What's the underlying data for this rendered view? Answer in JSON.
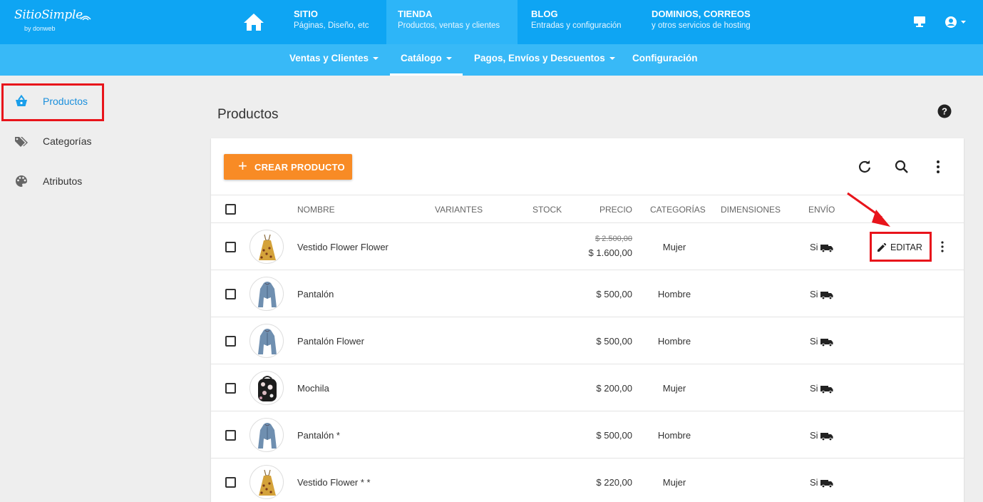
{
  "brand": {
    "script": "SitioSimple",
    "by": "by donweb"
  },
  "nav": [
    {
      "title": "SITIO",
      "subtitle": "Páginas, Diseño, etc"
    },
    {
      "title": "TIENDA",
      "subtitle": "Productos, ventas y clientes"
    },
    {
      "title": "BLOG",
      "subtitle": "Entradas y configuración"
    },
    {
      "title": "DOMINIOS, CORREOS",
      "subtitle": "y otros servicios de hosting"
    }
  ],
  "subnav": [
    {
      "label": "Ventas y Clientes"
    },
    {
      "label": "Catálogo"
    },
    {
      "label": "Pagos, Envíos y Descuentos"
    },
    {
      "label": "Configuración"
    }
  ],
  "sidebar": {
    "items": [
      {
        "label": "Productos",
        "icon": "basket-icon"
      },
      {
        "label": "Categorías",
        "icon": "tag-icon"
      },
      {
        "label": "Atributos",
        "icon": "palette-icon"
      }
    ]
  },
  "main": {
    "title": "Productos",
    "create_label": "CREAR PRODUCTO"
  },
  "table": {
    "headers": {
      "nombre": "NOMBRE",
      "variantes": "VARIANTES",
      "stock": "STOCK",
      "precio": "PRECIO",
      "categorias": "CATEGORÍAS",
      "dimensiones": "DIMENSIONES",
      "envio": "ENVÍO"
    },
    "rows": [
      {
        "name": "Vestido Flower Flower",
        "old_price": "$ 2.500,00",
        "price": "$ 1.600,00",
        "category": "Mujer",
        "shipping": "Si",
        "thumb": "dress"
      },
      {
        "name": "Pantalón",
        "price": "$ 500,00",
        "category": "Hombre",
        "shipping": "Si",
        "thumb": "jacket"
      },
      {
        "name": "Pantalón Flower",
        "price": "$ 500,00",
        "category": "Hombre",
        "shipping": "Si",
        "thumb": "jacket"
      },
      {
        "name": "Mochila",
        "price": "$ 200,00",
        "category": "Mujer",
        "shipping": "Si",
        "thumb": "backpack"
      },
      {
        "name": "Pantalón *",
        "price": "$ 500,00",
        "category": "Hombre",
        "shipping": "Si",
        "thumb": "jacket"
      },
      {
        "name": "Vestido Flower * *",
        "price": "$ 220,00",
        "category": "Mujer",
        "shipping": "Si",
        "thumb": "dress"
      }
    ],
    "edit_label": "EDITAR"
  },
  "colors": {
    "topbar": "#0ea5f3",
    "subbar": "#38b9f7",
    "accent_orange": "#f88b25",
    "highlight_red": "#e8141b",
    "active_link": "#1a8fdc"
  }
}
